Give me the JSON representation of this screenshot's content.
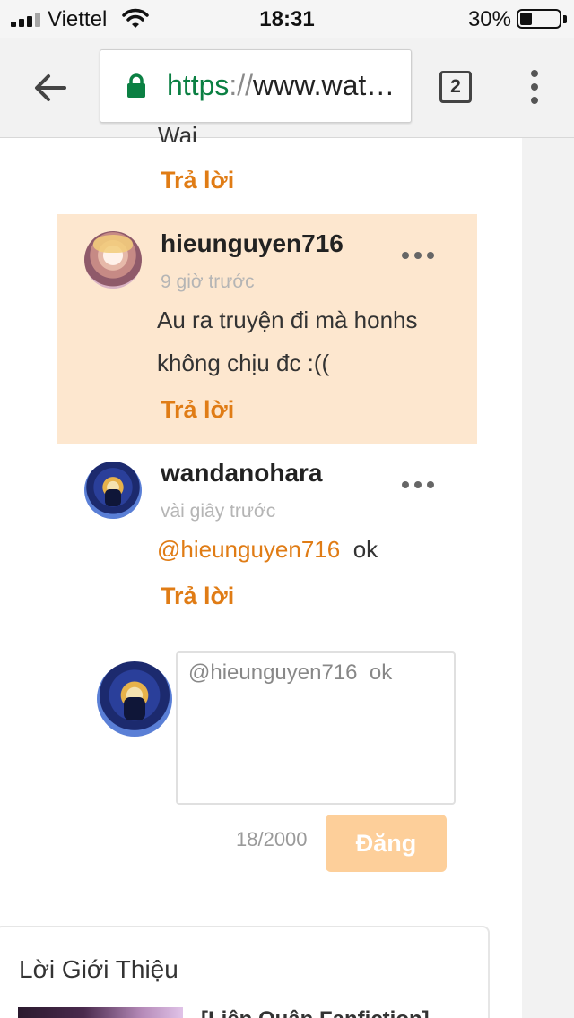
{
  "status_bar": {
    "carrier": "Viettel",
    "time": "18:31",
    "battery_percent_text": "30%",
    "battery_level": 0.3,
    "icons": [
      "signal-icon",
      "wifi-icon",
      "battery-icon"
    ]
  },
  "browser": {
    "url_scheme": "https",
    "url_separator": "://",
    "url_host": "www.wat…",
    "tab_count": "2",
    "icons": [
      "back-arrow-icon",
      "lock-icon",
      "tab-switcher-icon",
      "more-vert-icon"
    ]
  },
  "comments": {
    "previous_fragment": "Wai",
    "reply_label": "Trả lời",
    "items": [
      {
        "username": "hieunguyen716",
        "time": "9 giờ trước",
        "text": "Au  ra truyện đi mà honhs không chịu đc :((",
        "highlighted": true
      },
      {
        "username": "wandanohara",
        "time": "vài giây trước",
        "mention": "@hieunguyen716",
        "text": "ok",
        "highlighted": false
      }
    ]
  },
  "reply_form": {
    "value": "@hieunguyen716  ok",
    "char_count": "18/2000",
    "post_label": "Đăng"
  },
  "intro": {
    "title": "Lời Giới Thiệu",
    "snippet": "[Liên Quân Fanfiction]"
  },
  "colors": {
    "accent": "#e07c15",
    "highlight_bg": "#fde7cf",
    "post_button": "#fdcf9a",
    "secure_green": "#0b8043"
  }
}
